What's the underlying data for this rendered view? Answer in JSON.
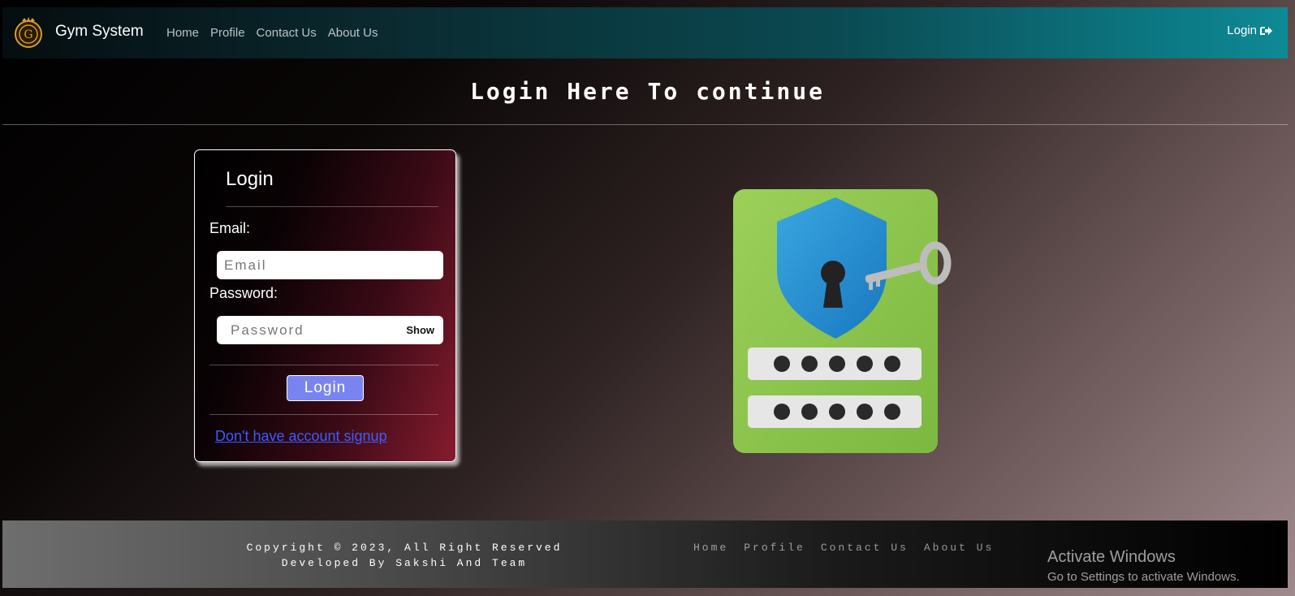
{
  "navbar": {
    "brand": "Gym System",
    "links": [
      "Home",
      "Profile",
      "Contact Us",
      "About Us"
    ],
    "login_label": "Login",
    "background_accent": "#0d8a96"
  },
  "page": {
    "title": "Login Here To continue"
  },
  "login_card": {
    "title": "Login",
    "email_label": "Email:",
    "email_placeholder": "Email",
    "password_label": "Password:",
    "password_placeholder": "Password",
    "show_label": "Show",
    "submit_label": "Login",
    "signup_link": "Don't have account signup"
  },
  "illustration": {
    "icon": "shield-keyhole-key-password-icon"
  },
  "footer": {
    "copyright_line1": "Copyright © 2023, All Right Reserved",
    "copyright_line2": "Developed By Sakshi And Team",
    "links": [
      "Home",
      "Profile",
      "Contact Us",
      "About Us"
    ]
  },
  "os_overlay": {
    "title": "Activate Windows",
    "subtitle": "Go to Settings to activate Windows."
  }
}
